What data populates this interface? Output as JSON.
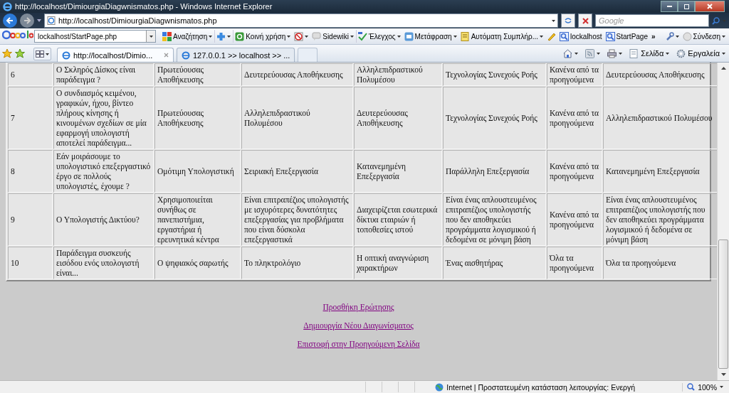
{
  "window": {
    "title": "http://localhost/DimiourgiaDiagwnismatos.php - Windows Internet Explorer"
  },
  "address_bar": {
    "url": "http://localhost/DimiourgiaDiagwnismatos.php",
    "search_placeholder": "Google"
  },
  "google_toolbar": {
    "search_value": "lockalhost/StartPage.php",
    "buttons": [
      {
        "kind": "search",
        "label": "Αναζήτηση",
        "dropdown": true
      },
      {
        "kind": "plus",
        "dropdown": true
      },
      {
        "kind": "share",
        "label": "Κοινή χρήση",
        "dropdown": true
      },
      {
        "kind": "block",
        "dropdown": true
      },
      {
        "kind": "sidewiki",
        "label": "Sidewiki",
        "dropdown": true
      },
      {
        "kind": "spell",
        "label": "Έλεγχος",
        "dropdown": true
      },
      {
        "kind": "translate",
        "label": "Μετάφραση",
        "dropdown": true
      },
      {
        "kind": "autofill",
        "label": "Αυτόματη Συμπλήρ...",
        "dropdown": true
      },
      {
        "kind": "pencil",
        "dropdown": false
      },
      {
        "kind": "bookmark",
        "label": "lockalhost",
        "dropdown": false
      },
      {
        "kind": "bookmark",
        "label": "StartPage",
        "dropdown": false
      },
      {
        "kind": "more",
        "label": "»",
        "dropdown": false
      },
      {
        "kind": "wrench",
        "dropdown": true
      },
      {
        "kind": "signin",
        "label": "Σύνδεση",
        "dropdown": true
      }
    ]
  },
  "tabs": [
    {
      "label": "http://localhost/Dimio...",
      "selected": true
    },
    {
      "label": "127.0.0.1 >> localhost >> ...",
      "selected": false
    }
  ],
  "command_bar": [
    {
      "kind": "home"
    },
    {
      "kind": "feed"
    },
    {
      "kind": "print"
    },
    {
      "kind": "page",
      "label": "Σελίδα"
    },
    {
      "kind": "tools",
      "label": "Εργαλεία"
    }
  ],
  "table": {
    "rows": [
      [
        "6",
        "Ο Σκληρός Δίσκος είναι παράδειγμα ?",
        "Πρωτεύουσας Αποθήκευσης",
        "Δευτερεύουσας Αποθήκευσης",
        "Αλληλεπιδραστικού Πολυμέσου",
        "Τεχνολογίας Συνεχούς Ροής",
        "Κανένα από τα προηγούμενα",
        "Δευτερεύουσας Αποθήκευσης"
      ],
      [
        "7",
        "Ο συνδιασμός κειμένου, γραφικών, ήχου, βίντεο πλήρους κίνησης ή κινουμένων σχεδίων σε μία εφαρμογή υπολογιστή αποτελεί παράδειγμα...",
        "Πρωτεύουσας Αποθήκευσης",
        "Αλληλεπιδραστικού Πολυμέσου",
        "Δευτερεύουσας Αποθήκευσης",
        "Τεχνολογίας Συνεχούς Ροής",
        "Κανένα από τα προηγούμενα",
        "Αλληλεπιδραστικού Πολυμέσου"
      ],
      [
        "8",
        "Εάν μοιράσουμε το υπολογιστικό επεξεργαστικό έργο σε πολλούς υπολογιστές, έχουμε ?",
        "Ομότιμη Υπολογιστική",
        "Σειριακή Επεξεργασία",
        "Κατανεμημένη Επεξεργασία",
        "Παράλληλη Επεξεργασία",
        "Κανένα από τα προηγούμενα",
        "Κατανεμημένη Επεξεργασία"
      ],
      [
        "9",
        "Ο Υπολογιστής Δικτύου?",
        "Χρησιμοποιείται συνήθως σε πανεπιστήμια, εργαστήρια ή ερευνητικά κέντρα",
        "Είναι επιτραπέζιος υπολογιστής με ισχυρότερες δυνατότητες επεξεργασίας για προβλήματα που είναι δύσκολα επεξεργαστικά",
        "Διαχειρίζεται εσωτερικά δίκτυα εταιριών ή τοποθεσίες ιστού",
        "Είναι ένας απλουστευμένος επιτραπέζιος υπολογιστής που δεν αποθηκεύει προγράμματα λογισμικού ή δεδομένα σε μόνιμη βάση",
        "Κανένα από τα προηγούμενα",
        "Είναι ένας απλουστευμένος επιτραπέζιος υπολογιστής που δεν αποθηκεύει προγράμματα λογισμικού ή δεδομένα σε μόνιμη βάση"
      ],
      [
        "10",
        "Παράδειγμα συσκευής εισόδου ενός υπολογιστή είναι...",
        "Ο ψηφιακός σαρωτής",
        "Το πληκτρολόγιο",
        "Η οπτική αναγνώριση χαρακτήρων",
        "Ένας αισθητήρας",
        "Όλα τα προηγούμενα",
        "Όλα τα προηγούμενα"
      ]
    ]
  },
  "links": [
    "Προσθήκη Ερώτησης",
    "Δημιουργία Νέου Διαγωνίσματος",
    "Επιστοφή στην Προηγούμενη Σελίδα"
  ],
  "status_bar": {
    "zone": "Internet | Προστατευμένη κατάσταση λειτουργίας: Ενεργή",
    "zoom": "100%"
  }
}
